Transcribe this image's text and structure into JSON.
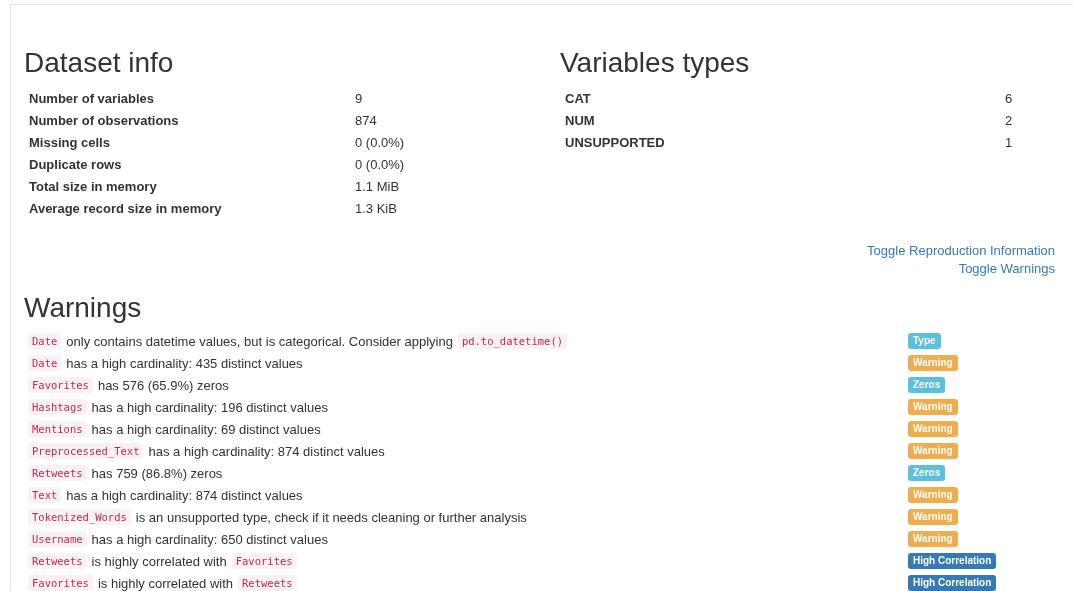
{
  "dataset_info": {
    "title": "Dataset info",
    "rows": [
      {
        "label": "Number of variables",
        "value": "9"
      },
      {
        "label": "Number of observations",
        "value": "874"
      },
      {
        "label": "Missing cells",
        "value": "0 (0.0%)"
      },
      {
        "label": "Duplicate rows",
        "value": "0 (0.0%)"
      },
      {
        "label": "Total size in memory",
        "value": "1.1 MiB"
      },
      {
        "label": "Average record size in memory",
        "value": "1.3 KiB"
      }
    ]
  },
  "variables_types": {
    "title": "Variables types",
    "rows": [
      {
        "label": "CAT",
        "value": "6"
      },
      {
        "label": "NUM",
        "value": "2"
      },
      {
        "label": "UNSUPPORTED",
        "value": "1"
      }
    ]
  },
  "links": [
    "Toggle Reproduction Information",
    "Toggle Warnings"
  ],
  "warnings": {
    "title": "Warnings",
    "rows": [
      {
        "parts": [
          {
            "kind": "code",
            "text": "Date"
          },
          {
            "kind": "text",
            "text": "only contains datetime values, but is categorical. Consider applying"
          },
          {
            "kind": "code",
            "text": "pd.to_datetime()"
          }
        ],
        "badge": {
          "kind": "type",
          "text": "Type"
        }
      },
      {
        "parts": [
          {
            "kind": "code",
            "text": "Date"
          },
          {
            "kind": "text",
            "text": "has a high cardinality: 435 distinct values"
          }
        ],
        "badge": {
          "kind": "warning",
          "text": "Warning"
        }
      },
      {
        "parts": [
          {
            "kind": "code",
            "text": "Favorites"
          },
          {
            "kind": "text",
            "text": "has 576 (65.9%) zeros"
          }
        ],
        "badge": {
          "kind": "zeros",
          "text": "Zeros"
        }
      },
      {
        "parts": [
          {
            "kind": "code",
            "text": "Hashtags"
          },
          {
            "kind": "text",
            "text": "has a high cardinality: 196 distinct values"
          }
        ],
        "badge": {
          "kind": "warning",
          "text": "Warning"
        }
      },
      {
        "parts": [
          {
            "kind": "code",
            "text": "Mentions"
          },
          {
            "kind": "text",
            "text": "has a high cardinality: 69 distinct values"
          }
        ],
        "badge": {
          "kind": "warning",
          "text": "Warning"
        }
      },
      {
        "parts": [
          {
            "kind": "code",
            "text": "Preprocessed_Text"
          },
          {
            "kind": "text",
            "text": "has a high cardinality: 874 distinct values"
          }
        ],
        "badge": {
          "kind": "warning",
          "text": "Warning"
        }
      },
      {
        "parts": [
          {
            "kind": "code",
            "text": "Retweets"
          },
          {
            "kind": "text",
            "text": "has 759 (86.8%) zeros"
          }
        ],
        "badge": {
          "kind": "zeros",
          "text": "Zeros"
        }
      },
      {
        "parts": [
          {
            "kind": "code",
            "text": "Text"
          },
          {
            "kind": "text",
            "text": "has a high cardinality: 874 distinct values"
          }
        ],
        "badge": {
          "kind": "warning",
          "text": "Warning"
        }
      },
      {
        "parts": [
          {
            "kind": "code",
            "text": "Tokenized_Words"
          },
          {
            "kind": "text",
            "text": "is an unsupported type, check if it needs cleaning or further analysis"
          }
        ],
        "badge": {
          "kind": "warning",
          "text": "Warning"
        }
      },
      {
        "parts": [
          {
            "kind": "code",
            "text": "Username"
          },
          {
            "kind": "text",
            "text": "has a high cardinality: 650 distinct values"
          }
        ],
        "badge": {
          "kind": "warning",
          "text": "Warning"
        }
      },
      {
        "parts": [
          {
            "kind": "code",
            "text": "Retweets"
          },
          {
            "kind": "text",
            "text": "is highly correlated with"
          },
          {
            "kind": "code",
            "text": "Favorites"
          }
        ],
        "badge": {
          "kind": "correlation",
          "text": "High Correlation"
        }
      },
      {
        "parts": [
          {
            "kind": "code",
            "text": "Favorites"
          },
          {
            "kind": "text",
            "text": "is highly correlated with"
          },
          {
            "kind": "code",
            "text": "Retweets"
          }
        ],
        "badge": {
          "kind": "correlation",
          "text": "High Correlation"
        }
      }
    ]
  }
}
